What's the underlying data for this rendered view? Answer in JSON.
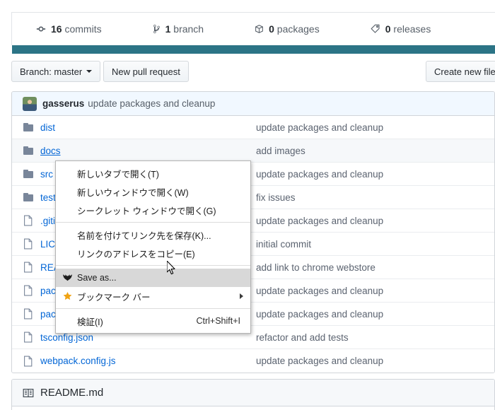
{
  "stats": [
    {
      "icon": "commit-icon",
      "count": "16",
      "label": "commits"
    },
    {
      "icon": "branch-icon",
      "count": "1",
      "label": "branch"
    },
    {
      "icon": "package-icon",
      "count": "0",
      "label": "packages"
    },
    {
      "icon": "tag-icon",
      "count": "0",
      "label": "releases"
    }
  ],
  "toolbar": {
    "branch_label": "Branch: master",
    "new_pull_request": "New pull request",
    "create_new_file": "Create new file"
  },
  "latest_commit": {
    "author": "gasserus",
    "message": "update packages and cleanup"
  },
  "files": [
    {
      "type": "dir",
      "name": "dist",
      "message": "update packages and cleanup"
    },
    {
      "type": "dir",
      "name": "docs",
      "message": "add images"
    },
    {
      "type": "dir",
      "name": "src",
      "message": "update packages and cleanup"
    },
    {
      "type": "dir",
      "name": "test",
      "message": "fix issues"
    },
    {
      "type": "file",
      "name": ".gitignore",
      "message": "update packages and cleanup"
    },
    {
      "type": "file",
      "name": "LICENSE",
      "message": "initial commit"
    },
    {
      "type": "file",
      "name": "README.md",
      "message": "add link to chrome webstore"
    },
    {
      "type": "file",
      "name": "package-lock.json",
      "message": "update packages and cleanup"
    },
    {
      "type": "file",
      "name": "package.json",
      "message": "update packages and cleanup"
    },
    {
      "type": "file",
      "name": "tsconfig.json",
      "message": "refactor and add tests"
    },
    {
      "type": "file",
      "name": "webpack.config.js",
      "message": "update packages and cleanup"
    }
  ],
  "readme": {
    "title": "README.md"
  },
  "context_menu": {
    "items": [
      {
        "id": "open-new-tab",
        "label": "新しいタブで開く(T)",
        "icon": "",
        "accel": "",
        "arrow": false,
        "highlight": false
      },
      {
        "id": "open-new-window",
        "label": "新しいウィンドウで開く(W)",
        "icon": "",
        "accel": "",
        "arrow": false,
        "highlight": false
      },
      {
        "id": "open-incognito",
        "label": "シークレット ウィンドウで開く(G)",
        "icon": "",
        "accel": "",
        "arrow": false,
        "highlight": false
      },
      {
        "id": "separator-1",
        "label": "",
        "icon": "",
        "accel": "",
        "arrow": false,
        "highlight": false
      },
      {
        "id": "save-link-as",
        "label": "名前を付けてリンク先を保存(K)...",
        "icon": "",
        "accel": "",
        "arrow": false,
        "highlight": false
      },
      {
        "id": "copy-link-address",
        "label": "リンクのアドレスをコピー(E)",
        "icon": "",
        "accel": "",
        "arrow": false,
        "highlight": false
      },
      {
        "id": "separator-2",
        "label": "",
        "icon": "",
        "accel": "",
        "arrow": false,
        "highlight": false
      },
      {
        "id": "save-as",
        "label": "Save as...",
        "icon": "bat-extension-icon",
        "accel": "",
        "arrow": false,
        "highlight": true
      },
      {
        "id": "bookmark-bar",
        "label": "ブックマーク バー",
        "icon": "star-icon",
        "accel": "",
        "arrow": true,
        "highlight": false
      },
      {
        "id": "separator-3",
        "label": "",
        "icon": "",
        "accel": "",
        "arrow": false,
        "highlight": false
      },
      {
        "id": "inspect",
        "label": "検証(I)",
        "icon": "",
        "accel": "Ctrl+Shift+I",
        "arrow": false,
        "highlight": false
      }
    ]
  },
  "colors": {
    "link": "#0366d6",
    "teal_band": "#2c7486",
    "highlight_row": "#d8d8d8",
    "latest_commit_bg": "#f1f8ff"
  }
}
